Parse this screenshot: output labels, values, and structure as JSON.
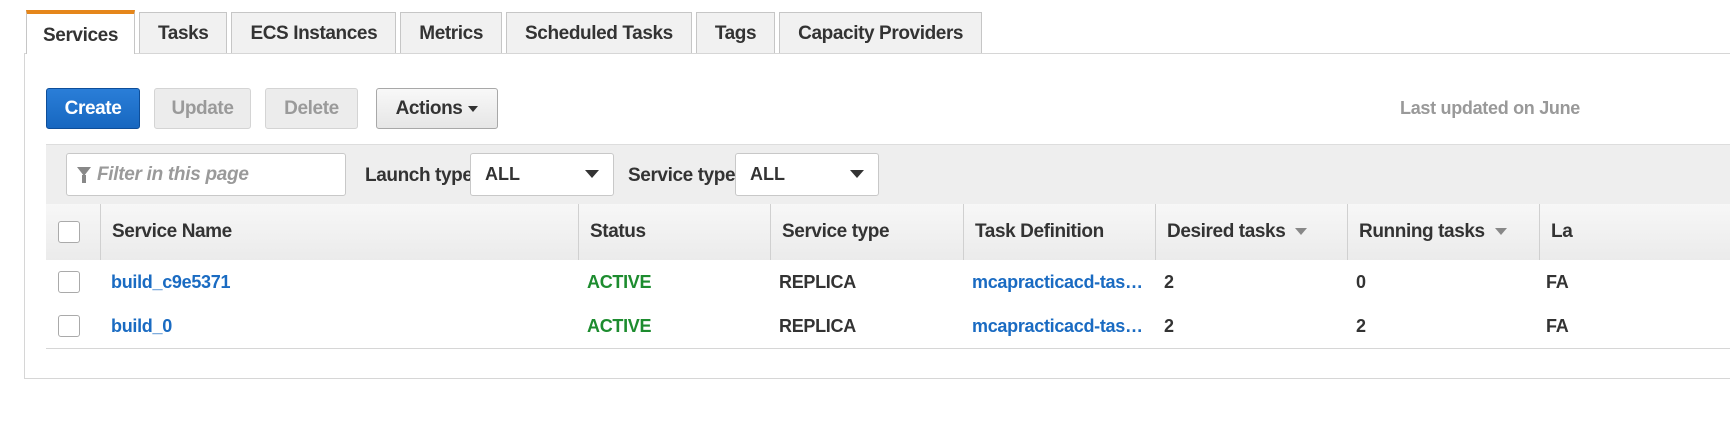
{
  "tabs": [
    {
      "label": "Services",
      "active": true
    },
    {
      "label": "Tasks"
    },
    {
      "label": "ECS Instances"
    },
    {
      "label": "Metrics"
    },
    {
      "label": "Scheduled Tasks"
    },
    {
      "label": "Tags"
    },
    {
      "label": "Capacity Providers"
    }
  ],
  "toolbar": {
    "create_label": "Create",
    "update_label": "Update",
    "delete_label": "Delete",
    "actions_label": "Actions",
    "last_updated": "Last updated on June"
  },
  "filters": {
    "search_placeholder": "Filter in this page",
    "launch_type_label": "Launch type",
    "launch_type_value": "ALL",
    "service_type_label": "Service type",
    "service_type_value": "ALL"
  },
  "table": {
    "columns": [
      "Service Name",
      "Status",
      "Service type",
      "Task Definition",
      "Desired tasks",
      "Running tasks",
      "La"
    ],
    "rows": [
      {
        "name": "build_c9e5371",
        "status": "ACTIVE",
        "service_type": "REPLICA",
        "task_definition": "mcapracticacd-tas…",
        "desired": "2",
        "running": "0",
        "launch": "FA"
      },
      {
        "name": "build_0",
        "status": "ACTIVE",
        "service_type": "REPLICA",
        "task_definition": "mcapracticacd-tas…",
        "desired": "2",
        "running": "2",
        "launch": "FA"
      }
    ]
  },
  "colors": {
    "primary": "#1767c0",
    "active_tab_accent": "#e5861b",
    "link": "#1a6bc2",
    "status_active": "#1d8c2f"
  }
}
